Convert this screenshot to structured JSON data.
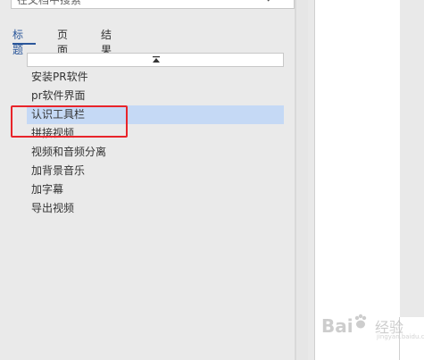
{
  "search": {
    "placeholder": "在文档中搜索"
  },
  "tabs": [
    {
      "label": "标题"
    },
    {
      "label": "页面"
    },
    {
      "label": "结果"
    }
  ],
  "headings": [
    {
      "label": "安装PR软件"
    },
    {
      "label": "pr软件界面"
    },
    {
      "label": "认识工具栏"
    },
    {
      "label": "拼接视频"
    },
    {
      "label": "视频和音频分离"
    },
    {
      "label": "加背景音乐"
    },
    {
      "label": "加字幕"
    },
    {
      "label": "导出视频"
    }
  ],
  "watermark": {
    "brand": "Bai",
    "brand2": "du",
    "cn": "经验",
    "sub": "jingyan.baidu.com"
  },
  "colors": {
    "accent": "#2b579a",
    "selected": "#c5d9f5",
    "annotation": "#e8242a"
  }
}
